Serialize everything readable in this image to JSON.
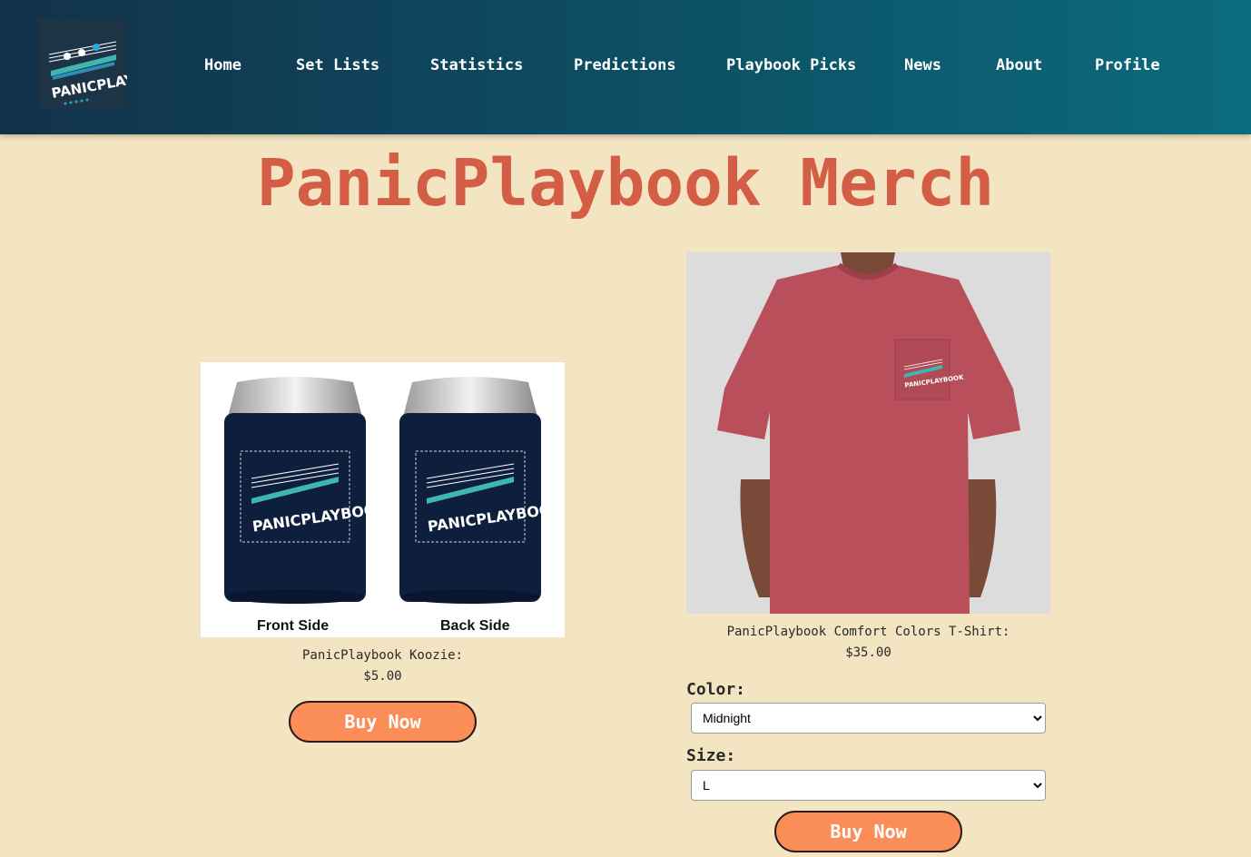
{
  "brand": {
    "logo_icon": "panicplaybook-logo-icon"
  },
  "nav": {
    "items": [
      {
        "label": "Home"
      },
      {
        "label": "Set Lists"
      },
      {
        "label": "Statistics"
      },
      {
        "label": "Predictions"
      },
      {
        "label": "Playbook Picks"
      },
      {
        "label": "News"
      },
      {
        "label": "About"
      },
      {
        "label": "Profile"
      }
    ]
  },
  "page": {
    "title": "PanicPlaybook Merch"
  },
  "products": [
    {
      "name": "PanicPlaybook Koozie:",
      "price": "$5.00",
      "image": {
        "front_caption": "Front Side",
        "back_caption": "Back Side"
      },
      "buy_label": "Buy Now"
    },
    {
      "name": "PanicPlaybook Comfort Colors T-Shirt:",
      "price": "$35.00",
      "color_label": "Color:",
      "color_selected": "Midnight",
      "size_label": "Size:",
      "size_selected": "L",
      "buy_label": "Buy Now"
    }
  ],
  "colors": {
    "header_start": "#12314a",
    "header_end": "#0b6b7c",
    "background": "#f3e4c2",
    "title": "#d45d45",
    "button": "#fa8d58",
    "koozie": "#0e1f3d",
    "shirt": "#b84f5b"
  }
}
